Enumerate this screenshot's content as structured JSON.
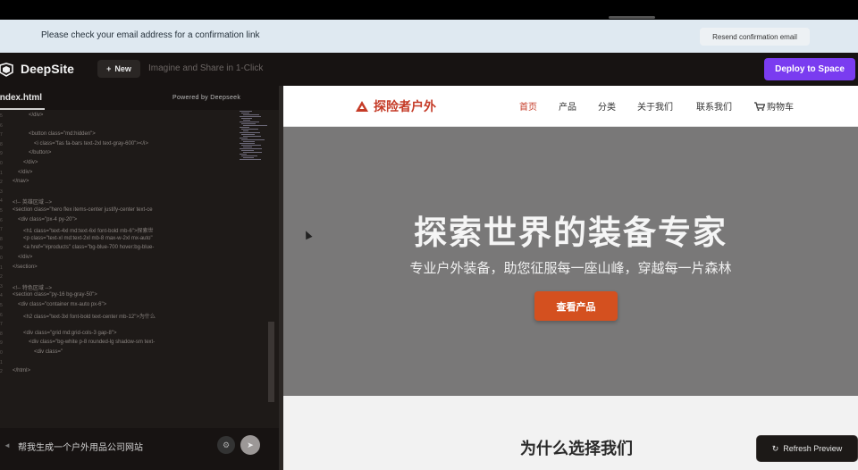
{
  "notice": {
    "text": "Please check your email address for a confirmation link",
    "resend_label": "Resend confirmation email"
  },
  "app": {
    "name": "DeepSite",
    "new_label": "New",
    "tagline": "Imagine and Share in 1-Click",
    "deploy_label": "Deploy to Space",
    "accent": "#7a3cf0"
  },
  "editor": {
    "tab_label": "index.html",
    "powered_by": "Powered by  Deepseek",
    "line_numbers": [
      "5",
      "6",
      "7",
      "8",
      "9",
      "0",
      "1",
      "2",
      "3",
      "4",
      "5",
      "6",
      "7",
      "8",
      "9",
      "0",
      "1",
      "2",
      "3",
      "4",
      "5",
      "6",
      "7",
      "8",
      "9",
      "0",
      "1",
      "2",
      "3",
      "4",
      "5",
      "6",
      "7",
      "8",
      "9"
    ],
    "code_lines": [
      {
        "indent": 6,
        "text": "</div>"
      },
      {
        "indent": 0,
        "text": ""
      },
      {
        "indent": 6,
        "text": "<button class=\"md:hidden\">"
      },
      {
        "indent": 8,
        "text": "<i class=\"fas fa-bars text-2xl text-gray-600\"></i>"
      },
      {
        "indent": 6,
        "text": "</button>"
      },
      {
        "indent": 4,
        "text": "</div>"
      },
      {
        "indent": 2,
        "text": "</div>"
      },
      {
        "indent": 0,
        "text": "</nav>"
      },
      {
        "indent": 0,
        "text": ""
      },
      {
        "indent": 0,
        "text": "<!-- 英雄区域 -->"
      },
      {
        "indent": 0,
        "text": "<section class=\"hero flex items-center justify-center text-ce"
      },
      {
        "indent": 2,
        "text": "<div class=\"px-4 py-20\">"
      },
      {
        "indent": 4,
        "text": "<h1 class=\"text-4xl md:text-6xl font-bold mb-6\">探索世"
      },
      {
        "indent": 4,
        "text": "<p class=\"text-xl md:text-2xl mb-8 max-w-2xl mx-auto\""
      },
      {
        "indent": 4,
        "text": "<a href=\"#products\" class=\"bg-blue-700 hover:bg-blue-"
      },
      {
        "indent": 2,
        "text": "</div>"
      },
      {
        "indent": 0,
        "text": "</section>"
      },
      {
        "indent": 0,
        "text": ""
      },
      {
        "indent": 0,
        "text": "<!-- 特色区域 -->"
      },
      {
        "indent": 0,
        "text": "<section class=\"py-16 bg-gray-50\">"
      },
      {
        "indent": 2,
        "text": "<div class=\"container mx-auto px-6\">"
      },
      {
        "indent": 4,
        "text": "<h2 class=\"text-3xl font-bold text-center mb-12\">为什么"
      },
      {
        "indent": 0,
        "text": ""
      },
      {
        "indent": 4,
        "text": "<div class=\"grid md:grid-cols-3 gap-8\">"
      },
      {
        "indent": 6,
        "text": "<div class=\"bg-white p-8 rounded-lg shadow-sm text-"
      },
      {
        "indent": 8,
        "text": "<div class=\""
      },
      {
        "indent": 0,
        "text": ""
      },
      {
        "indent": 0,
        "text": "</html>"
      }
    ],
    "prompt_text": "帮我生成一个户外用品公司网站"
  },
  "preview": {
    "logo_text": "探险者户外",
    "nav_items": [
      {
        "label": "首页",
        "active": true
      },
      {
        "label": "产品",
        "active": false
      },
      {
        "label": "分类",
        "active": false
      },
      {
        "label": "关于我们",
        "active": false
      },
      {
        "label": "联系我们",
        "active": false
      },
      {
        "label": "购物车",
        "active": false
      }
    ],
    "hero_title": "探索世界的装备专家",
    "hero_subtitle": "专业户外装备，助您征服每一座山峰，穿越每一片森林",
    "hero_button": "查看产品",
    "section_title": "为什么选择我们",
    "brand_color": "#c53b27",
    "button_color": "#d4501f"
  },
  "refresh_label": "Refresh Preview"
}
